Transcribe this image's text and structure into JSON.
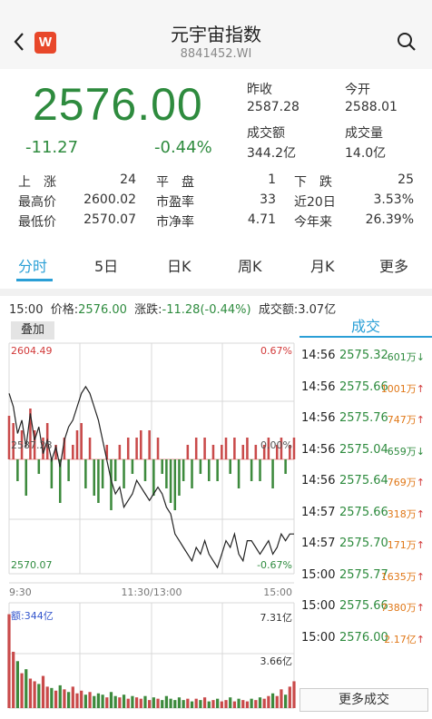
{
  "header": {
    "title": "元宇宙指数",
    "code": "8841452.WI",
    "logo_text": "W",
    "back_icon": "chevron-left-icon",
    "search_icon": "search-icon"
  },
  "quote": {
    "price": "2576.00",
    "change": "-11.27",
    "change_pct": "-0.44%",
    "prev_close_label": "昨收",
    "prev_close": "2587.28",
    "open_label": "今开",
    "open": "2588.01",
    "amount_label": "成交额",
    "amount": "344.2亿",
    "volume_label": "成交量",
    "volume": "14.0亿"
  },
  "stats": [
    [
      {
        "label": "上　涨",
        "value": "24"
      },
      {
        "label": "平　盘",
        "value": "1"
      },
      {
        "label": "下　跌",
        "value": "25"
      }
    ],
    [
      {
        "label": "最高价",
        "value": "2600.02"
      },
      {
        "label": "市盈率",
        "value": "33"
      },
      {
        "label": "近20日",
        "value": "3.53%"
      }
    ],
    [
      {
        "label": "最低价",
        "value": "2570.07"
      },
      {
        "label": "市净率",
        "value": "4.71"
      },
      {
        "label": "今年来",
        "value": "26.39%"
      }
    ]
  ],
  "tabs": [
    "分时",
    "5日",
    "日K",
    "周K",
    "月K",
    "更多"
  ],
  "active_tab": 0,
  "infoline": {
    "time": "15:00",
    "price_label": "价格:",
    "price": "2576.00",
    "change_label": "涨跌:",
    "change": "-11.28(-0.44%)",
    "amount_label": "成交额:",
    "amount": "3.07亿"
  },
  "chart": {
    "overlay_label": "叠加",
    "high_label": "2604.49",
    "high_pct": "0.67%",
    "low_label": "2570.07",
    "low_pct": "-0.67%",
    "mid_label": "2587.28",
    "mid_pct": "0.00%",
    "time_start": "9:30",
    "time_mid": "11:30/13:00",
    "time_end": "15:00",
    "vol_amount_label": "额:344亿",
    "vol_max": "7.31亿",
    "vol_mid": "3.66亿"
  },
  "chart_data": {
    "type": "line",
    "price_range": [
      2570.07,
      2604.49
    ],
    "prev_close": 2587.28,
    "price": [
      2597,
      2595,
      2591,
      2593,
      2589,
      2594,
      2590,
      2592,
      2588,
      2590,
      2587,
      2589,
      2586,
      2590,
      2592,
      2593,
      2595,
      2597,
      2598,
      2597,
      2595,
      2593,
      2590,
      2587,
      2584,
      2582,
      2583,
      2580,
      2581,
      2582,
      2584,
      2583,
      2582,
      2581,
      2582,
      2583,
      2582,
      2580,
      2579,
      2576,
      2575,
      2574,
      2573,
      2572,
      2574,
      2573,
      2575,
      2573,
      2572,
      2571,
      2573,
      2575,
      2574,
      2576,
      2573,
      2572,
      2575,
      2575,
      2574,
      2573,
      2574,
      2575,
      2573,
      2574,
      2576,
      2575,
      2576,
      2576
    ],
    "diff": [
      0.6,
      0.5,
      -0.3,
      0.4,
      -0.5,
      0.7,
      0.4,
      -0.2,
      0.3,
      0.5,
      -0.4,
      0.2,
      -0.6,
      0.3,
      -0.3,
      0.2,
      0.4,
      0.5,
      -0.4,
      0.3,
      -0.5,
      -0.6,
      -0.4,
      0.2,
      -0.7,
      -0.3,
      0.2,
      -0.4,
      0.3,
      -0.2,
      0.3,
      0.4,
      -0.3,
      0.4,
      -0.5,
      0.3,
      -0.2,
      -0.4,
      -0.6,
      -0.7,
      -0.5,
      -0.3,
      0.2,
      -0.4,
      0.3,
      -0.2,
      0.3,
      -0.3,
      0.2,
      -0.3,
      0.2,
      0.3,
      -0.2,
      0.3,
      -0.4,
      0.2,
      0.3,
      -0.3,
      0.2,
      -0.3,
      0.2,
      0.3,
      -0.4,
      0.2,
      0.3,
      -0.2,
      0.2,
      0.3
    ],
    "volume_ylim": [
      0,
      7.31
    ],
    "volume": [
      7.0,
      4.2,
      3.5,
      2.6,
      2.9,
      2.2,
      2.0,
      1.8,
      2.4,
      1.6,
      1.5,
      1.3,
      1.7,
      1.4,
      1.2,
      1.6,
      1.1,
      1.3,
      1.0,
      1.2,
      0.9,
      1.1,
      1.0,
      0.8,
      1.2,
      0.9,
      0.8,
      1.0,
      0.7,
      0.9,
      0.8,
      0.7,
      0.9,
      0.6,
      0.8,
      0.7,
      0.6,
      0.9,
      0.7,
      0.6,
      0.8,
      0.6,
      0.7,
      0.5,
      0.7,
      0.6,
      0.8,
      0.5,
      0.6,
      0.7,
      0.5,
      0.6,
      0.8,
      0.5,
      0.7,
      0.6,
      0.5,
      0.7,
      0.6,
      0.8,
      0.7,
      0.9,
      1.1,
      0.9,
      1.4,
      1.0,
      1.6,
      2.0
    ]
  },
  "trades_title": "成交",
  "trades": [
    {
      "time": "14:56",
      "price": "2575.32",
      "vol": "601万",
      "dir": "down"
    },
    {
      "time": "14:56",
      "price": "2575.66",
      "vol": "1001万",
      "dir": "up"
    },
    {
      "time": "14:56",
      "price": "2575.76",
      "vol": "747万",
      "dir": "up"
    },
    {
      "time": "14:56",
      "price": "2575.04",
      "vol": "659万",
      "dir": "down"
    },
    {
      "time": "14:56",
      "price": "2575.64",
      "vol": "769万",
      "dir": "up"
    },
    {
      "time": "14:57",
      "price": "2575.66",
      "vol": "318万",
      "dir": "up"
    },
    {
      "time": "14:57",
      "price": "2575.70",
      "vol": "171万",
      "dir": "up"
    },
    {
      "time": "15:00",
      "price": "2575.77",
      "vol": "1635万",
      "dir": "up"
    },
    {
      "time": "15:00",
      "price": "2575.66",
      "vol": "7380万",
      "dir": "up"
    },
    {
      "time": "15:00",
      "price": "2576.00",
      "vol": "2.17亿",
      "dir": "up"
    }
  ],
  "more_trades_label": "更多成交",
  "colors": {
    "up": "#d23a3a",
    "down": "#2e8b3e",
    "accent": "#2a9fd6",
    "vol_up": "#e07818"
  }
}
